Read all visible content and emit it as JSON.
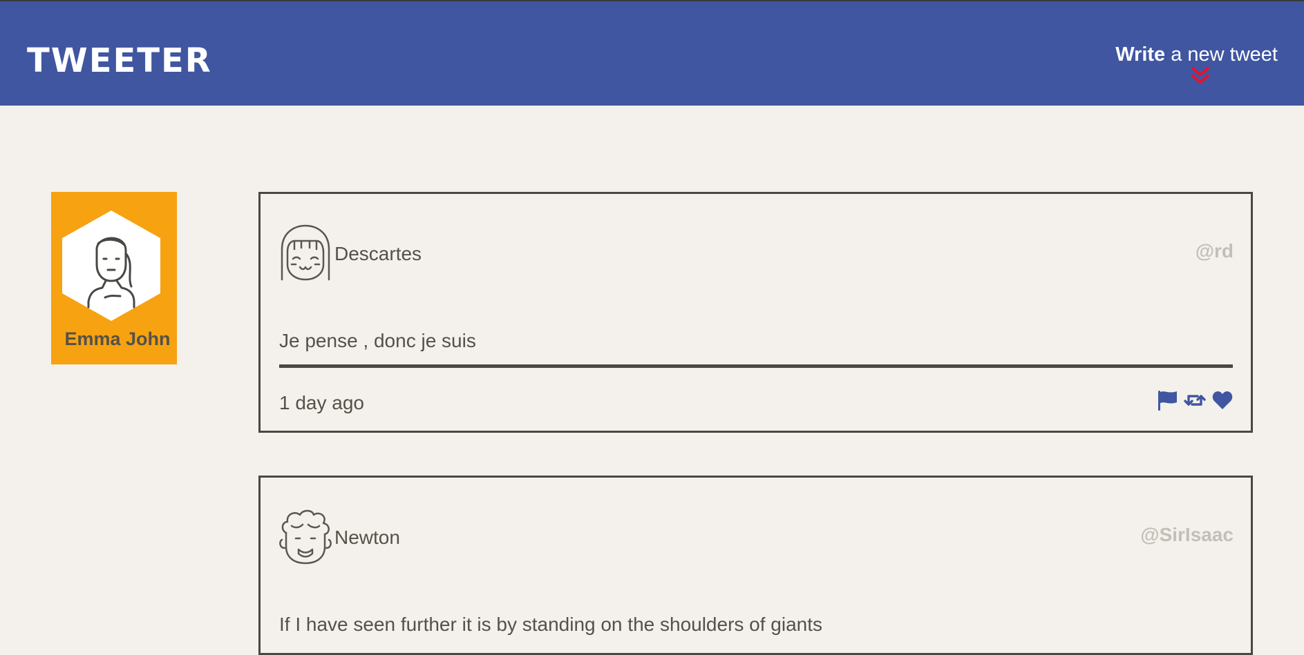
{
  "header": {
    "brand": "TWEETER",
    "compose_bold": "Write",
    "compose_rest": " a new tweet",
    "accent_color": "#4056a1",
    "chevron_color": "#e8112d"
  },
  "profile": {
    "name": "Emma John",
    "card_color": "#f7a211"
  },
  "tweets": [
    {
      "name": "Descartes",
      "handle": "@rd",
      "text": "Je pense , donc je suis",
      "time": "1 day ago"
    },
    {
      "name": "Newton",
      "handle": "@SirIsaac",
      "text": "If I have seen further it is by standing on the shoulders of giants"
    }
  ],
  "icons": [
    "chevron-double-down-icon",
    "avatar-girl-icon",
    "avatar-woman-icon",
    "avatar-curly-man-icon",
    "flag-icon",
    "retweet-icon",
    "heart-icon"
  ]
}
